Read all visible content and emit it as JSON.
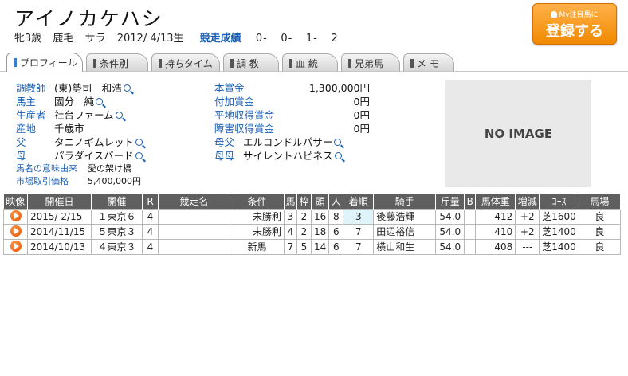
{
  "horse": {
    "name": "アイノカケハシ",
    "sex_age": "牝3歳",
    "coat": "鹿毛",
    "breed": "サラ",
    "birthdate": "2012/ 4/13生",
    "record_label": "競走成績",
    "record": [
      "0-",
      "0-",
      "1-",
      "2"
    ]
  },
  "register_button": {
    "small": "My注目馬に",
    "big": "登録する"
  },
  "tabs": [
    "プロフィール",
    "条件別",
    "持ちタイム",
    "調 教",
    "血 統",
    "兄弟馬",
    "メ モ"
  ],
  "profile": {
    "trainer_label": "調教師",
    "trainer": "(東)勢司　和浩",
    "owner_label": "馬主",
    "owner": "國分　純",
    "breeder_label": "生産者",
    "breeder": "社台ファーム",
    "birthplace_label": "産地",
    "birthplace": "千歳市",
    "sire_label": "父",
    "sire": "タニノギムレット",
    "dam_label": "母",
    "dam": "パラダイスバード",
    "name_origin_label": "馬名の意味由来",
    "name_origin": "愛の架け橋",
    "market_price_label": "市場取引価格",
    "market_price": "5,400,000円",
    "prize_main_label": "本賞金",
    "prize_main": "1,300,000円",
    "prize_add_label": "付加賞金",
    "prize_add": "0円",
    "prize_flat_label": "平地収得賞金",
    "prize_flat": "0円",
    "prize_jump_label": "障害収得賞金",
    "prize_jump": "0円",
    "broodmare_sire_label": "母父",
    "broodmare_sire": "エルコンドルパサー",
    "grand_dam_label": "母母",
    "grand_dam": "サイレントハピネス"
  },
  "no_image": "NO IMAGE",
  "table": {
    "headers": [
      "映像",
      "開催日",
      "開催",
      "R",
      "競走名",
      "条件",
      "馬",
      "枠",
      "頭",
      "人",
      "着順",
      "騎手",
      "斤量",
      "B",
      "馬体重",
      "増減",
      "ｺｰｽ",
      "馬場"
    ],
    "rows": [
      [
        "",
        "2015/ 2/15",
        "１東京６",
        "4",
        "",
        "未勝利",
        "3",
        "2",
        "16",
        "8",
        "3",
        "後藤浩輝",
        "54.0",
        "",
        "412",
        "+2",
        "芝1600",
        "良"
      ],
      [
        "",
        "2014/11/15",
        "５東京３",
        "4",
        "",
        "未勝利",
        "4",
        "2",
        "18",
        "6",
        "7",
        "田辺裕信",
        "54.0",
        "",
        "410",
        "+2",
        "芝1400",
        "良"
      ],
      [
        "",
        "2014/10/13",
        "４東京３",
        "4",
        "",
        "新馬",
        "7",
        "5",
        "14",
        "6",
        "7",
        "横山和生",
        "54.0",
        "",
        "408",
        "---",
        "芝1400",
        "良"
      ]
    ]
  }
}
